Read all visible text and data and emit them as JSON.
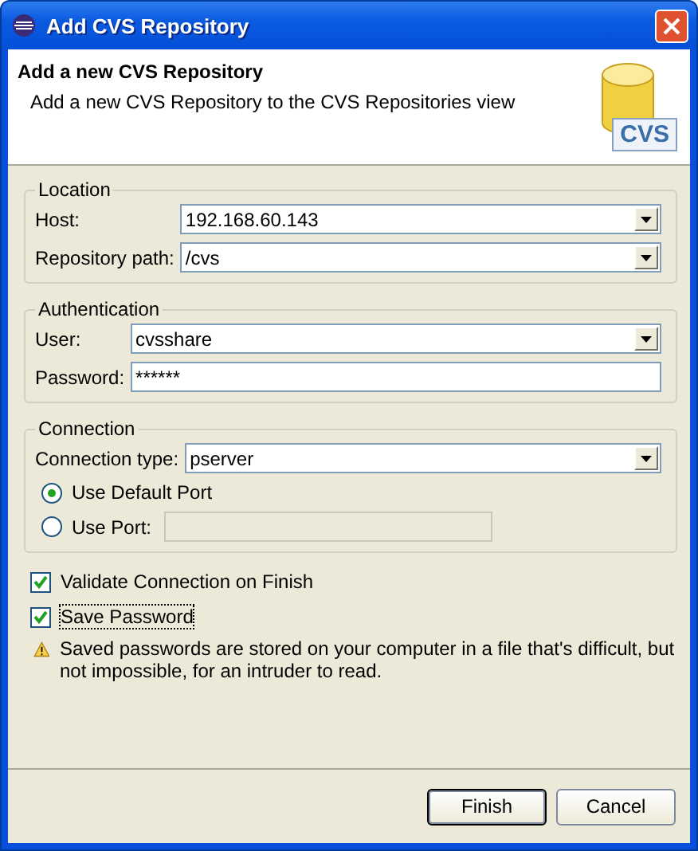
{
  "window": {
    "title": "Add CVS Repository"
  },
  "header": {
    "title": "Add a new CVS Repository",
    "description": "Add a new CVS Repository to the CVS Repositories view",
    "logo_text": "CVS"
  },
  "groups": [
    {
      "title": "Location",
      "fields": [
        {
          "kind": "combo",
          "label": "Host:",
          "value": "192.168.60.143"
        },
        {
          "kind": "combo",
          "label": "Repository path:",
          "value": "/cvs"
        }
      ]
    },
    {
      "title": "Authentication",
      "fields": [
        {
          "kind": "combo",
          "label": "User:",
          "value": "cvsshare"
        },
        {
          "kind": "text",
          "label": "Password:",
          "value": "******"
        }
      ]
    },
    {
      "title": "Connection",
      "fields": [
        {
          "kind": "combo",
          "label": "Connection type:",
          "value": "pserver"
        },
        {
          "kind": "radio",
          "label": "Use Default Port",
          "selected": true
        },
        {
          "kind": "radio_field",
          "label": "Use Port:",
          "selected": false,
          "disabled": true
        }
      ]
    }
  ],
  "checkboxes": [
    {
      "label": "Validate Connection on Finish",
      "checked": true,
      "focused": false
    },
    {
      "label": "Save Password",
      "checked": true,
      "focused": true
    }
  ],
  "warning": "Saved passwords are stored on your computer in a file that's difficult, but not impossible, for an intruder to read.",
  "buttons": [
    {
      "label": "Finish",
      "default": true
    },
    {
      "label": "Cancel",
      "default": false
    }
  ]
}
